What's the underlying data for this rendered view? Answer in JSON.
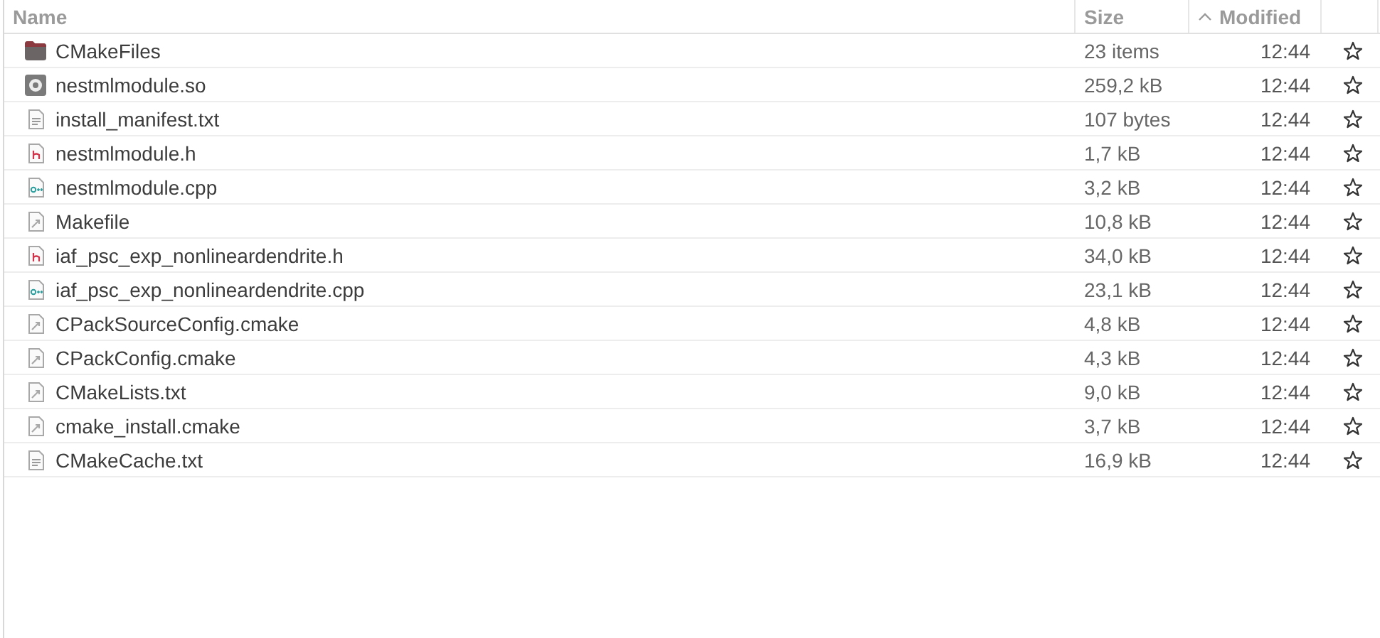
{
  "columns": [
    {
      "label": "Name",
      "sorted": false
    },
    {
      "label": "Size",
      "sorted": false
    },
    {
      "label": "Modified",
      "sorted": true
    }
  ],
  "files": [
    {
      "name": "CMakeFiles",
      "kind": "folder",
      "size": "23 items",
      "modified": "12:44",
      "starred": false
    },
    {
      "name": "nestmlmodule.so",
      "kind": "library",
      "size": "259,2 kB",
      "modified": "12:44",
      "starred": false
    },
    {
      "name": "install_manifest.txt",
      "kind": "text",
      "size": "107 bytes",
      "modified": "12:44",
      "starred": false
    },
    {
      "name": "nestmlmodule.h",
      "kind": "header",
      "size": "1,7 kB",
      "modified": "12:44",
      "starred": false
    },
    {
      "name": "nestmlmodule.cpp",
      "kind": "cpp",
      "size": "3,2 kB",
      "modified": "12:44",
      "starred": false
    },
    {
      "name": "Makefile",
      "kind": "script",
      "size": "10,8 kB",
      "modified": "12:44",
      "starred": false
    },
    {
      "name": "iaf_psc_exp_nonlineardendrite.h",
      "kind": "header",
      "size": "34,0 kB",
      "modified": "12:44",
      "starred": false
    },
    {
      "name": "iaf_psc_exp_nonlineardendrite.cpp",
      "kind": "cpp",
      "size": "23,1 kB",
      "modified": "12:44",
      "starred": false
    },
    {
      "name": "CPackSourceConfig.cmake",
      "kind": "script",
      "size": "4,8 kB",
      "modified": "12:44",
      "starred": false
    },
    {
      "name": "CPackConfig.cmake",
      "kind": "script",
      "size": "4,3 kB",
      "modified": "12:44",
      "starred": false
    },
    {
      "name": "CMakeLists.txt",
      "kind": "script",
      "size": "9,0 kB",
      "modified": "12:44",
      "starred": false
    },
    {
      "name": "cmake_install.cmake",
      "kind": "script",
      "size": "3,7 kB",
      "modified": "12:44",
      "starred": false
    },
    {
      "name": "CMakeCache.txt",
      "kind": "text",
      "size": "16,9 kB",
      "modified": "12:44",
      "starred": false
    }
  ]
}
